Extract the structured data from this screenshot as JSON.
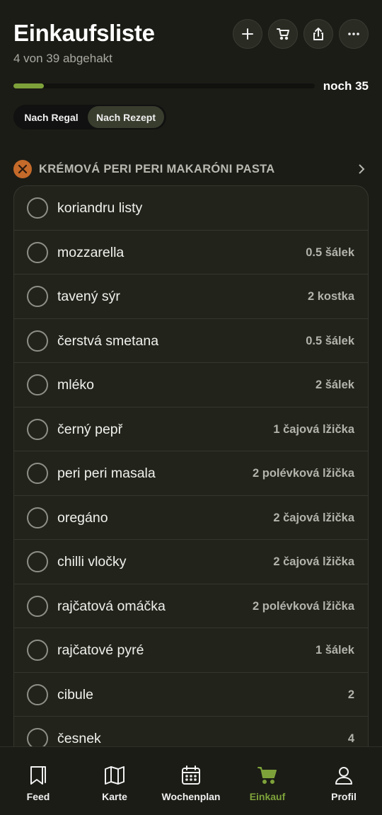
{
  "header": {
    "title": "Einkaufsliste",
    "subtitle": "4 von 39 abgehakt",
    "buttons": [
      {
        "icon": "plus-icon"
      },
      {
        "icon": "cart-icon"
      },
      {
        "icon": "share-icon"
      },
      {
        "icon": "more-icon"
      }
    ]
  },
  "progress": {
    "checked": 4,
    "total": 39,
    "fraction": 0.1,
    "label": "noch 35",
    "color": "#7ea23a"
  },
  "view_toggle": {
    "options": [
      "Nach Regal",
      "Nach Rezept"
    ],
    "selected": "Nach Rezept"
  },
  "recipe": {
    "title": "KRÉMOVÁ PERI PERI MAKARÓNI PASTA",
    "icon": "utensils-icon",
    "icon_color": "#c46a2a"
  },
  "items": [
    {
      "name": "koriandru listy",
      "qty": ""
    },
    {
      "name": "mozzarella",
      "qty": "0.5 šálek"
    },
    {
      "name": "tavený sýr",
      "qty": "2 kostka"
    },
    {
      "name": "čerstvá smetana",
      "qty": "0.5 šálek"
    },
    {
      "name": "mléko",
      "qty": "2 šálek"
    },
    {
      "name": "černý pepř",
      "qty": "1 čajová lžička"
    },
    {
      "name": "peri peri masala",
      "qty": "2 polévková lžička"
    },
    {
      "name": "oregáno",
      "qty": "2 čajová lžička"
    },
    {
      "name": "chilli vločky",
      "qty": "2 čajová lžička"
    },
    {
      "name": "rajčatová omáčka",
      "qty": "2 polévková lžička"
    },
    {
      "name": "rajčatové pyré",
      "qty": "1 šálek"
    },
    {
      "name": "cibule",
      "qty": "2"
    },
    {
      "name": "česnek",
      "qty": "4"
    }
  ],
  "nav": {
    "items": [
      {
        "label": "Feed",
        "icon": "bookmark-icon"
      },
      {
        "label": "Karte",
        "icon": "map-icon"
      },
      {
        "label": "Wochenplan",
        "icon": "calendar-icon"
      },
      {
        "label": "Einkauf",
        "icon": "cart-icon"
      },
      {
        "label": "Profil",
        "icon": "profile-icon"
      }
    ],
    "active": "Einkauf",
    "active_color": "#7ea23a"
  }
}
